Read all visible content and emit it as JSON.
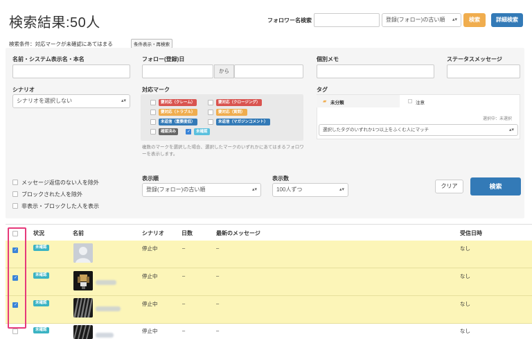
{
  "header": {
    "title": "検索結果:50人",
    "follower_search_label": "フォロワー名検索",
    "follower_search_value": "",
    "sort_select": "登録(フォロー)の古い順",
    "search_button": "検索",
    "detail_search_button": "詳細検索"
  },
  "conditions": {
    "text": "検索条件：対応マークが未確認にあてはまる",
    "toggle_button": "条件表示・再検索"
  },
  "filters": {
    "name_label": "名前・システム表示名・本名",
    "follow_date_label": "フォロー(登録)日",
    "follow_date_from": "から",
    "memo_label": "個別メモ",
    "status_msg_label": "ステータスメッセージ",
    "scenario_label": "シナリオ",
    "scenario_select": "シナリオを選択しない",
    "marks_label": "対応マーク",
    "marks": [
      {
        "label": "要対応（クレーム）",
        "color": "#d9534f",
        "checked": false
      },
      {
        "label": "要対応（クロージング）",
        "color": "#d9534f",
        "checked": false
      },
      {
        "label": "要対応（トラブル）",
        "color": "#f0ad4e",
        "checked": false
      },
      {
        "label": "要対応（質問）",
        "color": "#f0ad4e",
        "checked": false
      },
      {
        "label": "未返信（重要度低）",
        "color": "#337ab7",
        "checked": false
      },
      {
        "label": "未返信（マガジンコメント）",
        "color": "#337ab7",
        "checked": false
      },
      {
        "label": "確認済み",
        "color": "#666666",
        "checked": false
      },
      {
        "label": "未確認",
        "color": "#5bc0de",
        "checked": true
      }
    ],
    "marks_hint": "複数のマークを選択した場合、選択したマークのいずれかにあてはまるフォロワーを表示します。",
    "tag_label": "タグ",
    "tag_folder": "未分類",
    "tag_item": "注意",
    "tag_selected": "選択中：未選択",
    "tag_match_select": "選択したタグのいずれか1つ以上をふくむ人にマッチ",
    "exclude_options": [
      "メッセージ返信のない人を除外",
      "ブロックされた人を除外",
      "非表示・ブロックした人を表示"
    ],
    "order_label": "表示順",
    "order_select": "登録(フォロー)の古い順",
    "count_label": "表示数",
    "count_select": "100人ずつ",
    "clear_button": "クリア",
    "search_button": "検索"
  },
  "table": {
    "columns": [
      "状況",
      "名前",
      "シナリオ",
      "日数",
      "最新のメッセージ",
      "受信日時"
    ],
    "rows": [
      {
        "status": "未確認",
        "scenario": "停止中",
        "days": "–",
        "message": "–",
        "received": "なし",
        "checked": true,
        "highlight": true
      },
      {
        "status": "未確認",
        "scenario": "停止中",
        "days": "–",
        "message": "–",
        "received": "なし",
        "checked": true,
        "highlight": true
      },
      {
        "status": "未確認",
        "scenario": "停止中",
        "days": "–",
        "message": "–",
        "received": "なし",
        "checked": true,
        "highlight": true
      },
      {
        "status": "未確認",
        "scenario": "停止中",
        "days": "–",
        "message": "–",
        "received": "なし",
        "checked": false,
        "highlight": false
      }
    ]
  }
}
